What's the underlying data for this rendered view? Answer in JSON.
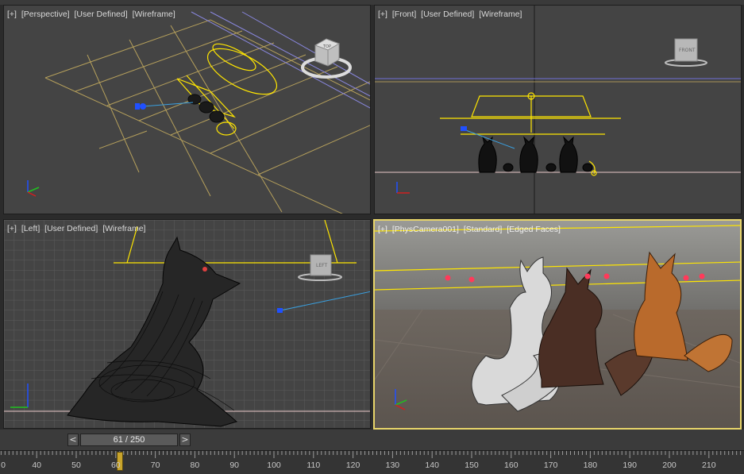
{
  "viewports": {
    "perspective": {
      "labels": [
        "[+]",
        "[Perspective]",
        "[User Defined]",
        "[Wireframe]"
      ],
      "cube_face": "TOP"
    },
    "front": {
      "labels": [
        "[+]",
        "[Front]",
        "[User Defined]",
        "[Wireframe]"
      ],
      "cube_face": "FRONT"
    },
    "left": {
      "labels": [
        "[+]",
        "[Left]",
        "[User Defined]",
        "[Wireframe]"
      ],
      "cube_face": "LEFT"
    },
    "camera": {
      "labels": [
        "[+]",
        "[PhysCamera001]",
        "[Standard]",
        "[Edged Faces]"
      ]
    }
  },
  "axes": {
    "x": "x",
    "y": "y",
    "z": "z"
  },
  "timeslider": {
    "prev": "<",
    "next": ">",
    "frame_text": "61 / 250"
  },
  "trackbar": {
    "ticks": [
      "0",
      "40",
      "50",
      "60",
      "70",
      "80",
      "90",
      "100",
      "110",
      "120",
      "130",
      "140",
      "150",
      "160",
      "170",
      "180",
      "190",
      "200",
      "210"
    ],
    "current_frame": 61
  },
  "colors": {
    "viewport_bg": "#444444",
    "selection": "#ffe600",
    "active_border": "#e8d56a",
    "grid": "#5a5a5a",
    "axis_x": "#d02020",
    "axis_y": "#20c020",
    "axis_z": "#2050ff"
  }
}
